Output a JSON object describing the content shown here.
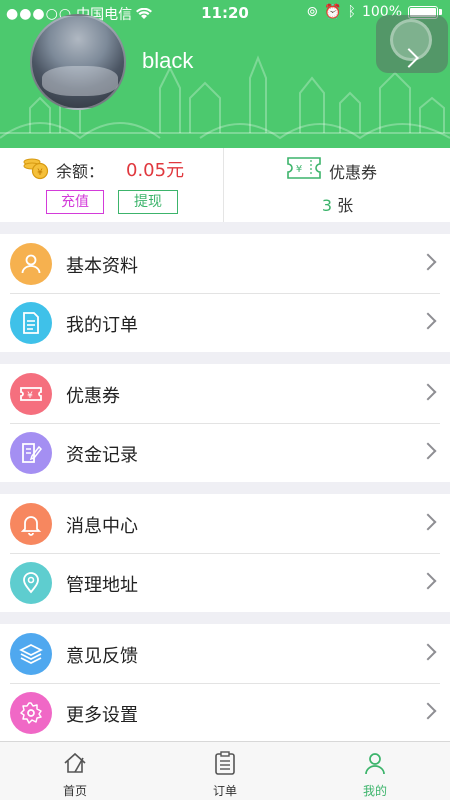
{
  "status_bar": {
    "carrier": "中国电信",
    "time": "11:20",
    "battery": "100%"
  },
  "profile": {
    "username": "black"
  },
  "balance": {
    "label": "余额：",
    "value": "0.05元",
    "recharge_label": "充值",
    "withdraw_label": "提现"
  },
  "coupon": {
    "label": "优惠券",
    "count": "3",
    "unit": "张"
  },
  "menu": {
    "profile_info": "基本资料",
    "my_orders": "我的订单",
    "coupons": "优惠券",
    "fund_records": "资金记录",
    "messages": "消息中心",
    "addresses": "管理地址",
    "feedback": "意见反馈",
    "settings": "更多设置"
  },
  "tabbar": {
    "home": "首页",
    "orders": "订单",
    "mine": "我的"
  },
  "colors": {
    "header_green": "#4cc96e",
    "accent_green": "#3cb46b",
    "balance_red": "#e0383e"
  }
}
